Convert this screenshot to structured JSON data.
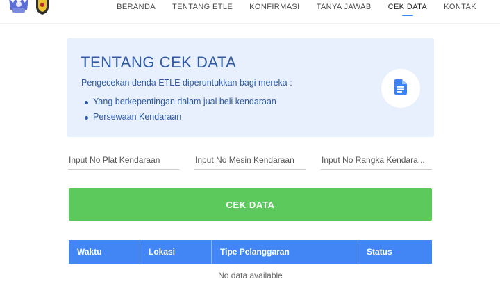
{
  "header": {
    "nav": [
      {
        "label": "BERANDA",
        "name": "nav-beranda"
      },
      {
        "label": "TENTANG ETLE",
        "name": "nav-tentang-etle"
      },
      {
        "label": "KONFIRMASI",
        "name": "nav-konfirmasi"
      },
      {
        "label": "TANYA JAWAB",
        "name": "nav-tanya-jawab"
      },
      {
        "label": "CEK DATA",
        "name": "nav-cek-data",
        "active": true
      },
      {
        "label": "KONTAK",
        "name": "nav-kontak"
      }
    ],
    "accent_color": "#3b82f6"
  },
  "info": {
    "title": "TENTANG CEK DATA",
    "description": "Pengecekan denda ETLE diperuntukkan bagi mereka :",
    "items": [
      "Yang berkepentingan dalam jual beli kendaraan",
      "Persewaan Kendaraan"
    ],
    "icon": "document-icon",
    "background_color": "#e8f0fd",
    "text_color": "#2e5aa6"
  },
  "form": {
    "plat_placeholder": "Input No Plat Kendaraan",
    "plat_value": "",
    "mesin_placeholder": "Input No Mesin Kendaraan",
    "mesin_value": "",
    "rangka_placeholder": "Input No Rangka Kendara...",
    "rangka_value": "",
    "submit_label": "CEK DATA",
    "submit_color": "#5cc95c"
  },
  "table": {
    "columns": [
      "Waktu",
      "Lokasi",
      "Tipe Pelanggaran",
      "Status"
    ],
    "empty_text": "No data available",
    "header_color": "#4285f4"
  }
}
